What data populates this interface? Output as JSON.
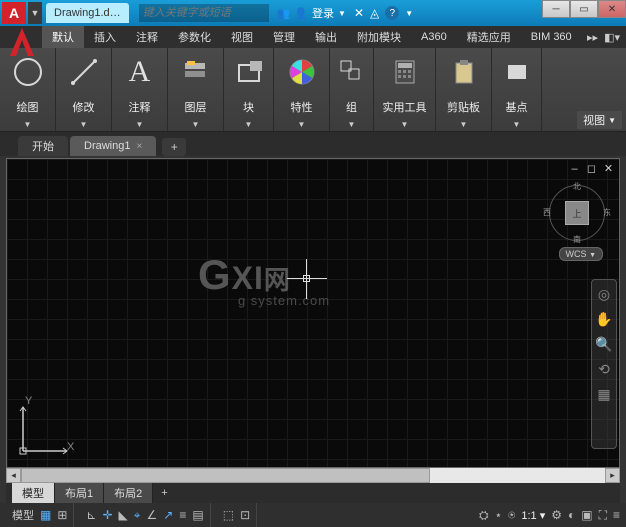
{
  "titlebar": {
    "doc_name": "Drawing1.d…",
    "search_placeholder": "键入关键字或短语",
    "login_label": "登录"
  },
  "ribbon_tabs": {
    "items": [
      "默认",
      "插入",
      "注释",
      "参数化",
      "视图",
      "管理",
      "输出",
      "附加模块",
      "A360",
      "精选应用",
      "BIM 360"
    ]
  },
  "ribbon_panels": {
    "draw": "绘图",
    "modify": "修改",
    "annotate": "注释",
    "layer": "图层",
    "block": "块",
    "properties": "特性",
    "group": "组",
    "utilities": "实用工具",
    "clipboard": "剪贴板",
    "datum": "基点",
    "view_label": "视图"
  },
  "file_tabs": {
    "start": "开始",
    "drawing": "Drawing1"
  },
  "viewcube": {
    "top": "上",
    "north": "北",
    "south": "南",
    "east": "东",
    "west": "西",
    "wcs": "WCS"
  },
  "ucs": {
    "x": "X",
    "y": "Y"
  },
  "layout_tabs": {
    "model": "模型",
    "layout1": "布局1",
    "layout2": "布局2"
  },
  "statusbar": {
    "model": "模型",
    "scale": "1:1"
  },
  "watermark": {
    "line1_a": "G",
    "line1_b": "XI",
    "line1_c": "网",
    "line2": "g system.com"
  }
}
